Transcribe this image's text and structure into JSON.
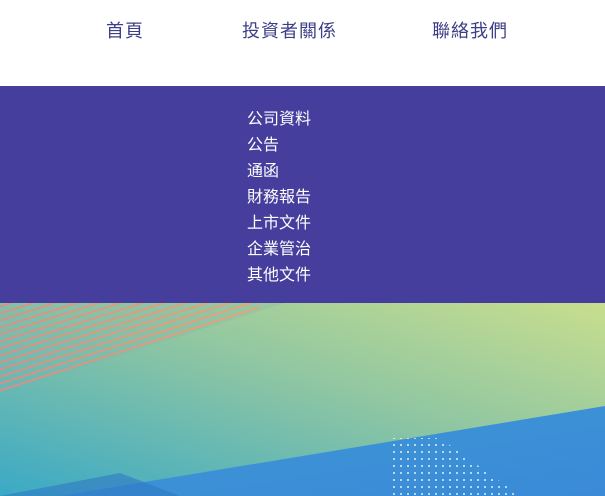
{
  "nav": {
    "items": [
      {
        "label": "首頁"
      },
      {
        "label": "投資者關係"
      },
      {
        "label": "聯絡我們"
      }
    ]
  },
  "dropdown": {
    "items": [
      {
        "label": "公司資料"
      },
      {
        "label": "公告"
      },
      {
        "label": "通函"
      },
      {
        "label": "財務報告"
      },
      {
        "label": "上市文件"
      },
      {
        "label": "企業管治"
      },
      {
        "label": "其他文件"
      }
    ]
  },
  "theme": {
    "nav_text_color": "#3d3f86",
    "dropdown_bg": "#453e9d",
    "dropdown_text": "#ffffff",
    "hero_gradient_start": "#3aa9c6",
    "hero_gradient_end": "#c8de8e",
    "hero_lower_band": "#3b8fd6"
  }
}
